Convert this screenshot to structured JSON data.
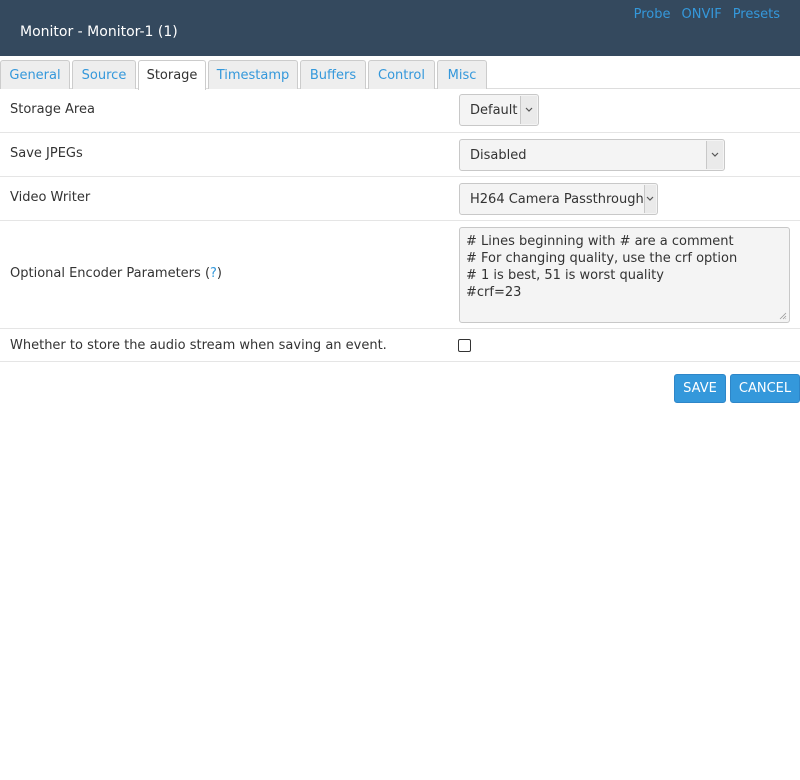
{
  "header": {
    "title": "Monitor - Monitor-1 (1)",
    "links": [
      "Probe",
      "ONVIF",
      "Presets"
    ]
  },
  "tabs": [
    "General",
    "Source",
    "Storage",
    "Timestamp",
    "Buffers",
    "Control",
    "Misc"
  ],
  "active_tab": "Storage",
  "form": {
    "storage_area": {
      "label": "Storage Area",
      "value": "Default"
    },
    "save_jpegs": {
      "label": "Save JPEGs",
      "value": "Disabled"
    },
    "video_writer": {
      "label": "Video Writer",
      "value": "H264 Camera Passthrough"
    },
    "encoder_params": {
      "label": "Optional Encoder Parameters",
      "help_open": "(",
      "help": "?",
      "help_close": ")",
      "lines": [
        "# Lines beginning with # are a comment",
        "# For changing quality, use the crf option",
        "# 1 is best, 51 is worst quality",
        "#crf=23"
      ]
    },
    "audio": {
      "label": "Whether to store the audio stream when saving an event.",
      "checked": false
    }
  },
  "buttons": {
    "save": "SAVE",
    "cancel": "CANCEL"
  },
  "colors": {
    "header_bg": "#34495e",
    "accent": "#3498db"
  }
}
